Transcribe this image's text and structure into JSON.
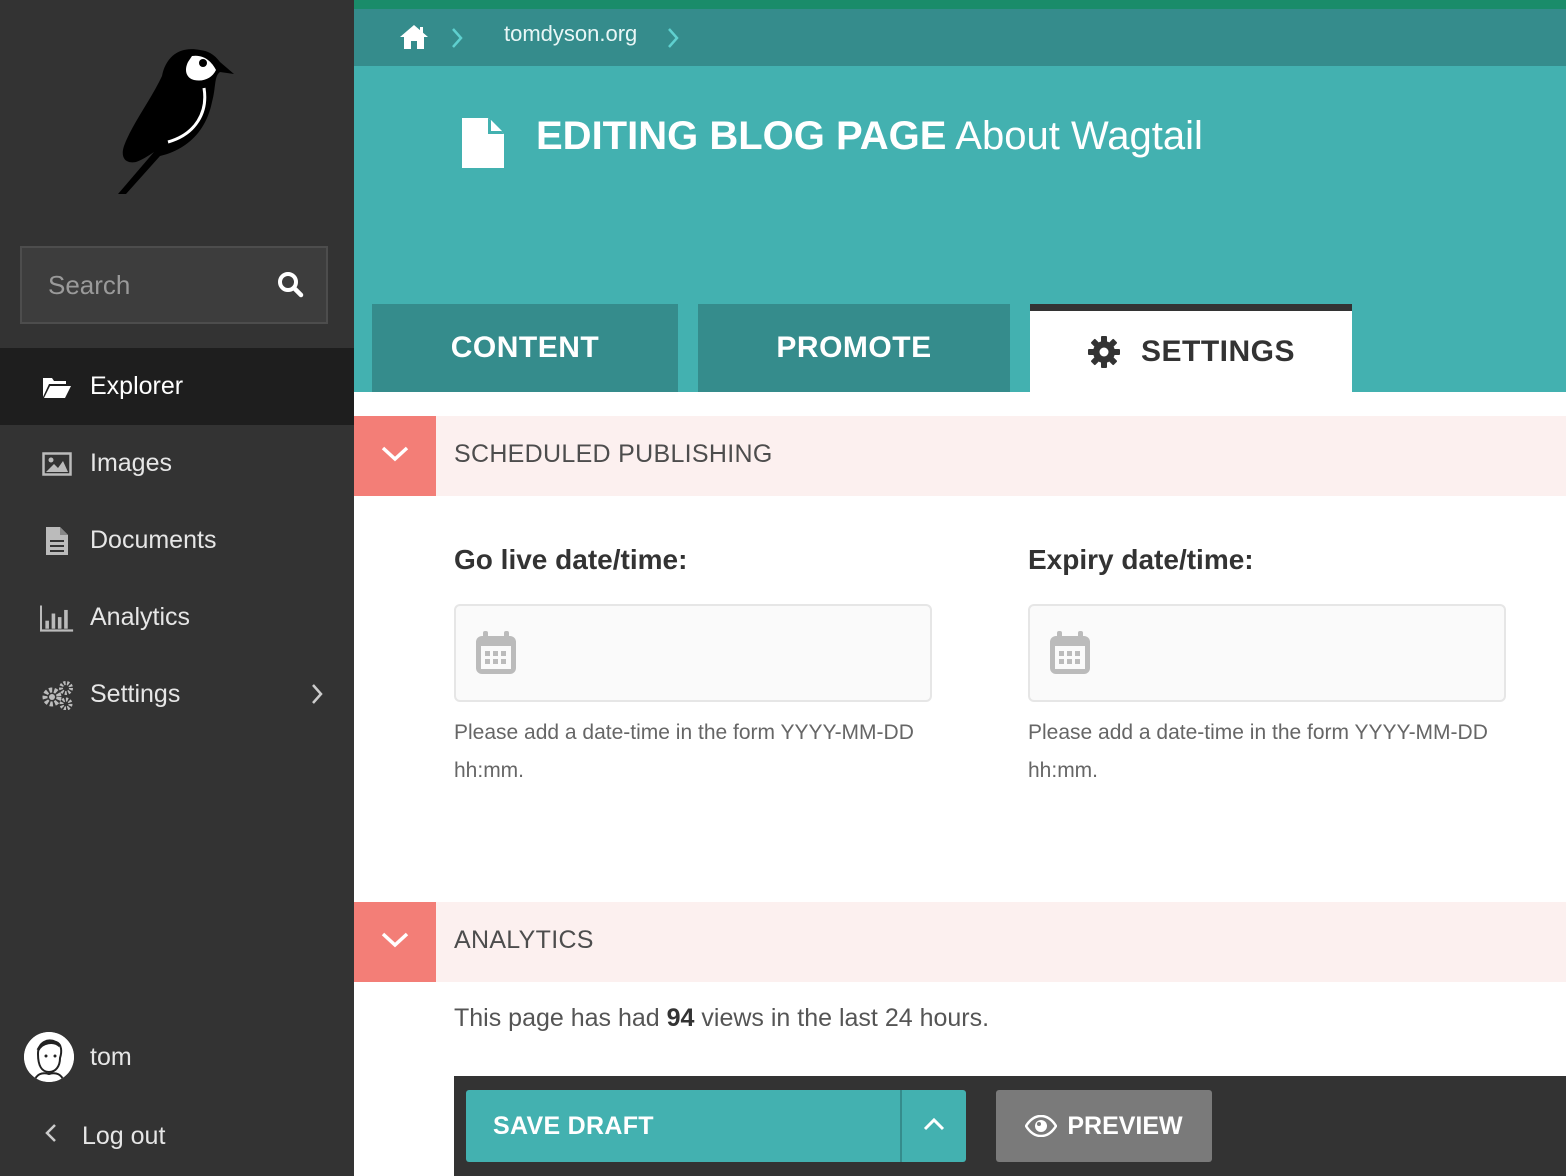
{
  "sidebar": {
    "search": {
      "placeholder": "Search"
    },
    "items": [
      {
        "label": "Explorer",
        "icon": "folder-open-icon",
        "active": true
      },
      {
        "label": "Images",
        "icon": "image-icon"
      },
      {
        "label": "Documents",
        "icon": "document-icon"
      },
      {
        "label": "Analytics",
        "icon": "bar-chart-icon"
      },
      {
        "label": "Settings",
        "icon": "cogs-icon",
        "has_submenu": true
      }
    ],
    "user": {
      "name": "tom"
    },
    "logout": {
      "label": "Log out"
    }
  },
  "breadcrumb": {
    "site": "tomdyson.org"
  },
  "header": {
    "kind": "EDITING BLOG PAGE",
    "page_title": "About Wagtail"
  },
  "tabs": [
    {
      "label": "CONTENT"
    },
    {
      "label": "PROMOTE"
    },
    {
      "label": "SETTINGS",
      "active": true
    }
  ],
  "scheduled": {
    "title": "SCHEDULED PUBLISHING",
    "go_live": {
      "label": "Go live date/time:",
      "value": "",
      "help": "Please add a date-time in the form YYYY-MM-DD hh:mm."
    },
    "expiry": {
      "label": "Expiry date/time:",
      "value": "",
      "help": "Please add a date-time in the form YYYY-MM-DD hh:mm."
    }
  },
  "analytics": {
    "title": "ANALYTICS",
    "text_before": "This page has had ",
    "views": "94",
    "text_after": " views in the last 24 hours."
  },
  "footer": {
    "save_label": "SAVE DRAFT",
    "preview_label": "PREVIEW"
  },
  "colors": {
    "teal": "#43b1b0",
    "dark_teal": "#358c8c",
    "sidebar": "#333333",
    "salmon": "#f37e77",
    "panel_bg": "#fcf0ef"
  }
}
